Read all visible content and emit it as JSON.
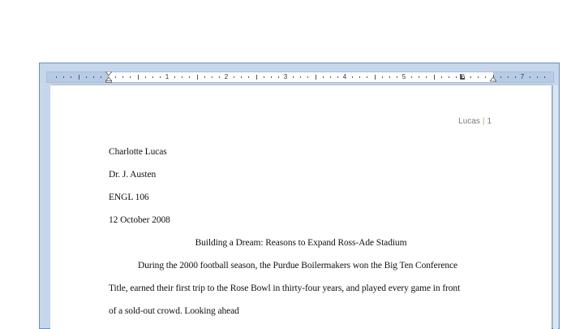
{
  "ruler": {
    "numbers": [
      "1",
      "2",
      "3",
      "4",
      "5",
      "6",
      "7"
    ]
  },
  "header": {
    "name": "Lucas",
    "separator": "|",
    "page": "1"
  },
  "document": {
    "lines": [
      "Charlotte Lucas",
      "Dr. J. Austen",
      "ENGL 106",
      "12 October 2008",
      "Building a Dream: Reasons to Expand Ross-Ade Stadium",
      "During the 2000 football season, the Purdue Boilermakers  won the Big Ten Conference",
      "Title, earned their first trip to the Rose Bowl in thirty-four years, and played every game in front",
      "of a sold-out crowd.  Looking ahead"
    ]
  },
  "colors": {
    "frame": "#c6d7ec",
    "ruler_margin": "#b8cbe4",
    "header_text": "#7a7a7a",
    "header_separator": "#c7a56f"
  }
}
